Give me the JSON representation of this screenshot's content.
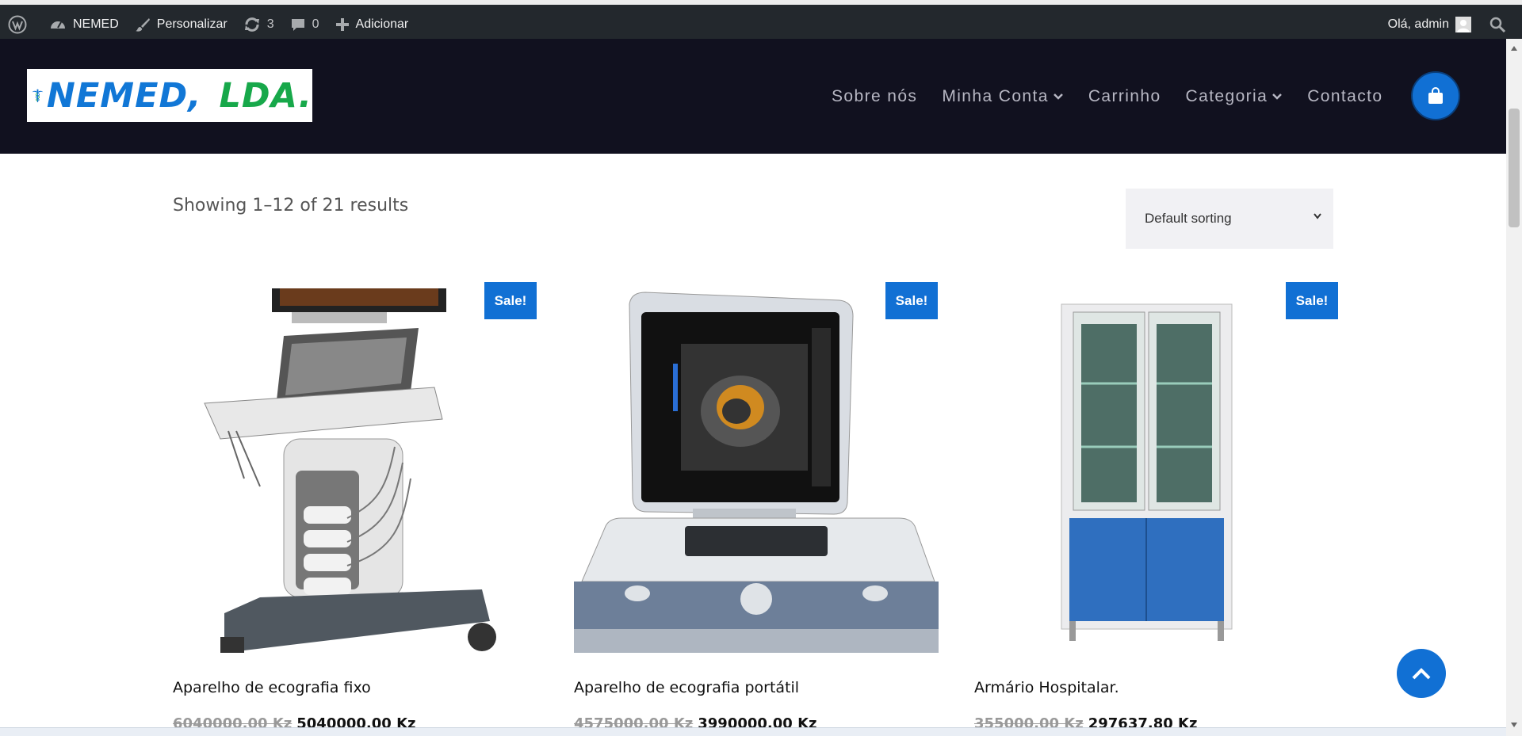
{
  "adminbar": {
    "site_name": "NEMED",
    "customize": "Personalizar",
    "updates_count": "3",
    "comments_count": "0",
    "add_new": "Adicionar",
    "greeting": "Olá, admin"
  },
  "header": {
    "logo_text_1": "NEMED,",
    "logo_text_2": "LDA.",
    "nav": [
      "Sobre nós",
      "Minha Conta",
      "Carrinho",
      "Categoria",
      "Contacto"
    ]
  },
  "shop": {
    "result_count": "Showing 1–12 of 21 results",
    "sorting_selected": "Default sorting"
  },
  "products": [
    {
      "title": "Aparelho de ecografia fixo",
      "old_price": "6040000,00 Kz",
      "new_price": "5040000,00 Kz",
      "badge": "Sale!"
    },
    {
      "title": "Aparelho de ecografia portátil",
      "old_price": "4575000,00 Kz",
      "new_price": "3990000,00 Kz",
      "badge": "Sale!"
    },
    {
      "title": "Armário Hospitalar.",
      "old_price": "355000,00 Kz",
      "new_price": "297637,80 Kz",
      "badge": "Sale!"
    }
  ],
  "colors": {
    "accent": "#1170d4",
    "header_bg": "#11111f",
    "adminbar_bg": "#23282d",
    "logo_blue": "#1177d6",
    "logo_green": "#17a84a"
  },
  "icons": [
    "wordpress-icon",
    "dashboard-icon",
    "brush-icon",
    "updates-icon",
    "comment-icon",
    "plus-icon",
    "search-icon",
    "shopping-bag-icon",
    "chevron-up-icon",
    "chevron-down-icon",
    "caduceus-icon"
  ]
}
